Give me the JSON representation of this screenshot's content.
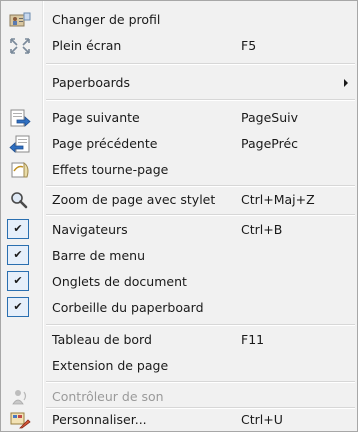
{
  "menu": {
    "items": [
      {
        "label": "Changer de profil",
        "shortcut": "",
        "icon": "profile-icon"
      },
      {
        "label": "Plein écran",
        "shortcut": "F5",
        "icon": "fullscreen-icon"
      },
      {
        "label": "Paperboards",
        "shortcut": "",
        "icon": "",
        "submenu": true
      },
      {
        "label": "Page suivante",
        "shortcut": "PageSuiv",
        "icon": "next-page-icon"
      },
      {
        "label": "Page précédente",
        "shortcut": "PagePréc",
        "icon": "previous-page-icon"
      },
      {
        "label": "Effets tourne-page",
        "shortcut": "",
        "icon": "page-turn-icon"
      },
      {
        "label": "Zoom de page avec stylet",
        "shortcut": "Ctrl+Maj+Z",
        "icon": "magnifier-icon"
      },
      {
        "label": "Navigateurs",
        "shortcut": "Ctrl+B",
        "checked": true
      },
      {
        "label": "Barre de menu",
        "shortcut": "",
        "checked": true
      },
      {
        "label": "Onglets de document",
        "shortcut": "",
        "checked": true
      },
      {
        "label": "Corbeille du paperboard",
        "shortcut": "",
        "checked": true
      },
      {
        "label": "Tableau de bord",
        "shortcut": "F11",
        "icon": ""
      },
      {
        "label": "Extension de page",
        "shortcut": "",
        "icon": ""
      },
      {
        "label": "Contrôleur de son",
        "shortcut": "",
        "icon": "sound-controller-icon",
        "disabled": true
      },
      {
        "label": "Personnaliser...",
        "shortcut": "Ctrl+U",
        "icon": "customize-icon"
      }
    ],
    "check_glyph": "✔"
  }
}
